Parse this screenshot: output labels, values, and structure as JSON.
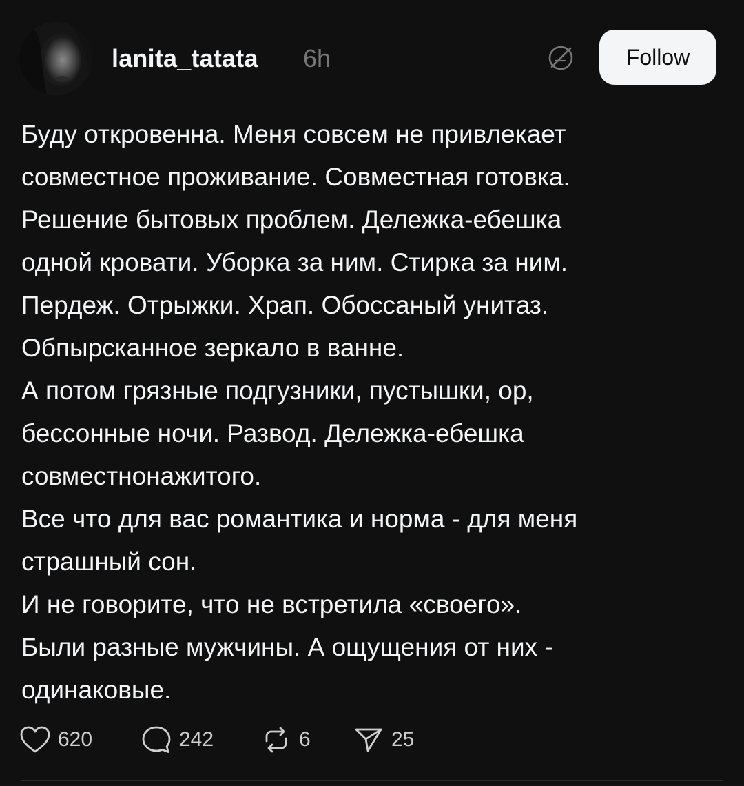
{
  "post": {
    "username": "lanita_tatata",
    "timestamp": "6h",
    "follow_label": "Follow",
    "mute_icon": "mute-icon",
    "avatar": "user-avatar-photo",
    "body_lines": [
      "Буду откровенна. Меня совсем не привлекает",
      "совместное проживание. Совместная готовка.",
      "Решение бытовых проблем. Дележка-ебешка",
      "одной кровати. Уборка за ним. Стирка за ним.",
      "Пердеж. Отрыжки. Храп. Обоссаный унитаз.",
      "Обпырсканное зеркало в ванне.",
      "А потом грязные подгузники, пустышки, ор,",
      "бессонные ночи. Развод. Дележка-ебешка",
      "совместнонажитого.",
      "Все что для вас романтика и норма - для меня",
      "страшный сон.",
      "И не говорите, что не встретила «своего».",
      "Были разные мужчины. А ощущения от них -",
      "одинаковые."
    ],
    "actions": {
      "likes": "620",
      "comments": "242",
      "reposts": "6",
      "shares": "25"
    }
  },
  "colors": {
    "background": "#101010",
    "text": "#f3f5f7",
    "muted": "#777777",
    "button_bg": "#f3f5f7"
  }
}
